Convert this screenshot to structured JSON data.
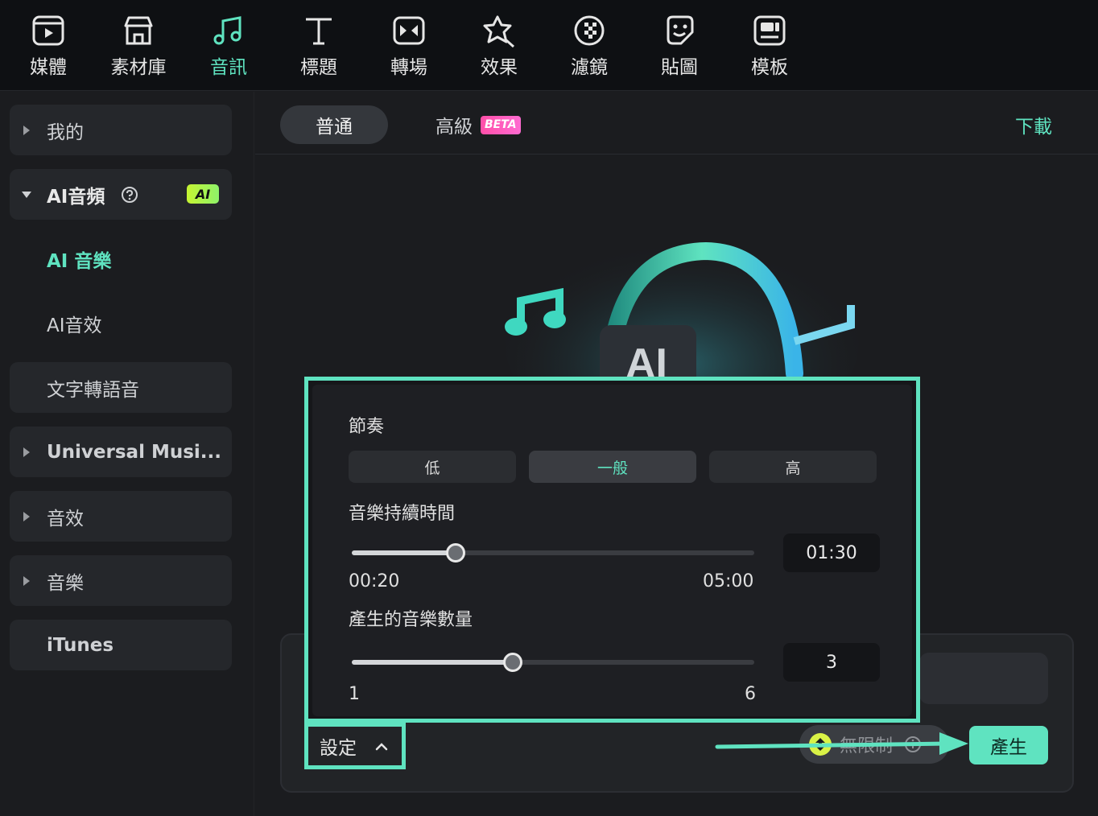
{
  "toolbar": {
    "items": [
      {
        "label": "媒體",
        "icon": "media-icon"
      },
      {
        "label": "素材庫",
        "icon": "store-icon"
      },
      {
        "label": "音訊",
        "icon": "music-note-icon",
        "active": true
      },
      {
        "label": "標題",
        "icon": "title-text-icon"
      },
      {
        "label": "轉場",
        "icon": "transition-icon"
      },
      {
        "label": "效果",
        "icon": "effects-icon"
      },
      {
        "label": "濾鏡",
        "icon": "filter-icon"
      },
      {
        "label": "貼圖",
        "icon": "sticker-icon"
      },
      {
        "label": "模板",
        "icon": "template-icon"
      }
    ]
  },
  "sidebar": {
    "items": [
      {
        "label": "我的"
      },
      {
        "label": "AI音頻",
        "badge": "AI"
      },
      {
        "label": "AI 音樂"
      },
      {
        "label": "AI音效"
      },
      {
        "label": "文字轉語音"
      },
      {
        "label": "Universal Musi..."
      },
      {
        "label": "音效"
      },
      {
        "label": "音樂"
      },
      {
        "label": "iTunes"
      }
    ]
  },
  "main": {
    "tabs": [
      {
        "label": "普通",
        "active": true
      },
      {
        "label": "高級",
        "badge": "BETA"
      }
    ],
    "download_label": "下載"
  },
  "popup": {
    "tempo": {
      "label": "節奏",
      "options": [
        "低",
        "一般",
        "高"
      ],
      "selected": "一般"
    },
    "duration": {
      "label": "音樂持續時間",
      "min": "00:20",
      "max": "05:00",
      "value": "01:30",
      "fraction": 0.2589
    },
    "count": {
      "label": "產生的音樂數量",
      "min": "1",
      "max": "6",
      "value": "3",
      "fraction": 0.4
    }
  },
  "footer": {
    "settings_label": "設定",
    "credits_label": "無限制",
    "generate_label": "產生"
  },
  "colors": {
    "accent": "#5fe3c0",
    "ai_badge": "#c6f432",
    "beta_badge": "#ff4fa8"
  }
}
